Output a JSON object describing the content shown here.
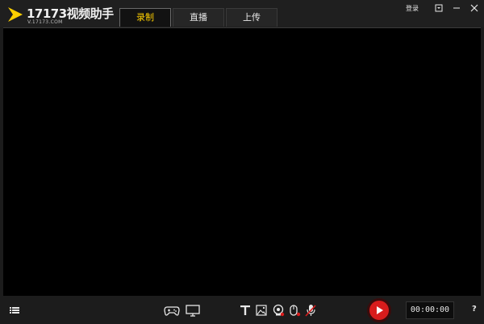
{
  "app": {
    "name": "17173视频助手",
    "sub": "V.17173.COM",
    "accent": "#ffd000"
  },
  "tabs": [
    {
      "label": "录制",
      "active": true
    },
    {
      "label": "直播",
      "active": false
    },
    {
      "label": "上传",
      "active": false
    }
  ],
  "header": {
    "login_label": "登录"
  },
  "icons": {
    "menu": "list-icon",
    "gamepad": "gamepad-icon",
    "monitor": "monitor-icon",
    "text": "text-icon",
    "image": "image-icon",
    "webcam": "webcam-icon",
    "mouse": "mouse-icon",
    "microphone": "microphone-icon",
    "record": "record-icon"
  },
  "recording": {
    "timer": "00:00:00",
    "record_color": "#d81c1c"
  },
  "footer": {
    "help_label": "?"
  }
}
